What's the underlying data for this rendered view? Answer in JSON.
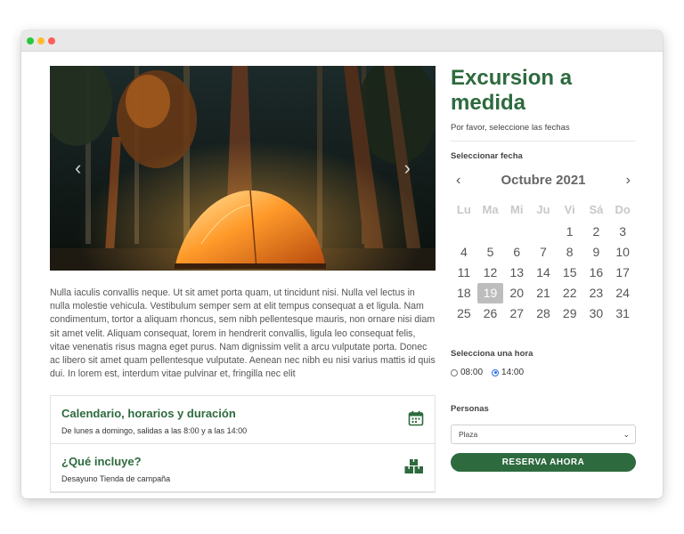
{
  "product": {
    "title": "Excursion a medida",
    "subtitle": "Por favor, seleccione las fechas"
  },
  "hero": {
    "image_alt": "Tienda de campaña iluminada en un bosque de noche",
    "prev_icon": "chevron-left-icon",
    "next_icon": "chevron-right-icon"
  },
  "description": "Nulla iaculis convallis neque. Ut sit amet porta quam, ut tincidunt nisi. Nulla vel lectus in nulla molestie vehicula. Vestibulum semper sem at elit tempus consequat a et ligula. Nam condimentum, tortor a aliquam rhoncus, sem nibh pellentesque mauris, non ornare nisi diam sit amet velit. Aliquam consequat, lorem in hendrerit convallis, ligula leo consequat felis, vitae venenatis risus magna eget purus. Nam dignissim velit a arcu vulputate porta. Donec ac libero sit amet quam pellentesque vulputate. Aenean nec nibh eu nisi varius mattis id quis dui. In lorem est, interdum vitae pulvinar et, fringilla nec elit",
  "accordion": [
    {
      "title": "Calendario, horarios y duración",
      "subtitle": "De lunes a domingo, salidas a las 8:00 y a las 14:00",
      "icon": "calendar-icon"
    },
    {
      "title": "¿Qué incluye?",
      "subtitle": "Desayuno Tienda de campaña",
      "icon": "boxes-icon"
    }
  ],
  "calendar": {
    "label": "Seleccionar fecha",
    "month": "Octubre 2021",
    "weekdays": [
      "Lu",
      "Ma",
      "Mi",
      "Ju",
      "Vi",
      "Sá",
      "Do"
    ],
    "leading_blanks": 4,
    "days": [
      "1",
      "2",
      "3",
      "4",
      "5",
      "6",
      "7",
      "8",
      "9",
      "10",
      "11",
      "12",
      "13",
      "14",
      "15",
      "16",
      "17",
      "18",
      "19",
      "20",
      "21",
      "22",
      "23",
      "24",
      "25",
      "26",
      "27",
      "28",
      "29",
      "30",
      "31"
    ],
    "selected_day": "19",
    "prev_icon": "chevron-left-icon",
    "next_icon": "chevron-right-icon"
  },
  "time": {
    "label": "Selecciona una hora",
    "options": [
      {
        "label": "08:00",
        "checked": false
      },
      {
        "label": "14:00",
        "checked": true
      }
    ]
  },
  "persons": {
    "label": "Personas",
    "selected": "Plaza"
  },
  "cta": {
    "label": "RESERVA AHORA"
  },
  "colors": {
    "brand_green": "#2d6a3e",
    "selected_day_bg": "#bdbdbd",
    "radio_blue": "#2a6ae9"
  }
}
